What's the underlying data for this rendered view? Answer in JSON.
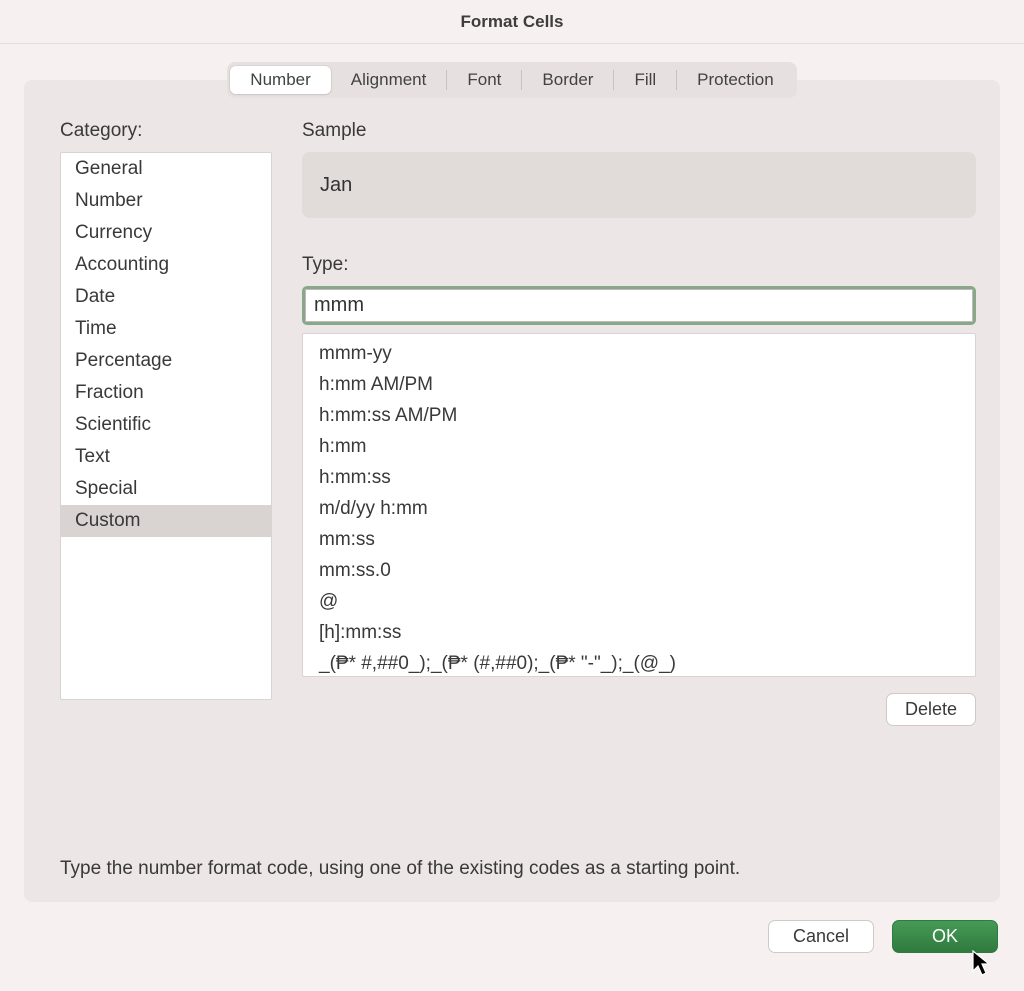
{
  "dialog": {
    "title": "Format Cells"
  },
  "tabs": {
    "items": [
      "Number",
      "Alignment",
      "Font",
      "Border",
      "Fill",
      "Protection"
    ],
    "activeIndex": 0
  },
  "category": {
    "label": "Category:",
    "items": [
      "General",
      "Number",
      "Currency",
      "Accounting",
      "Date",
      "Time",
      "Percentage",
      "Fraction",
      "Scientific",
      "Text",
      "Special",
      "Custom"
    ],
    "selectedIndex": 11
  },
  "sample": {
    "label": "Sample",
    "value": "Jan"
  },
  "type": {
    "label": "Type:",
    "value": "mmm",
    "formats": [
      "mmm-yy",
      "h:mm AM/PM",
      "h:mm:ss AM/PM",
      "h:mm",
      "h:mm:ss",
      "m/d/yy h:mm",
      "mm:ss",
      "mm:ss.0",
      "@",
      "[h]:mm:ss",
      "_(₱* #,##0_);_(₱* (#,##0);_(₱* \"-\"_);_(@_)"
    ]
  },
  "buttons": {
    "delete": "Delete",
    "cancel": "Cancel",
    "ok": "OK"
  },
  "hint": "Type the number format code, using one of the existing codes as a starting point."
}
